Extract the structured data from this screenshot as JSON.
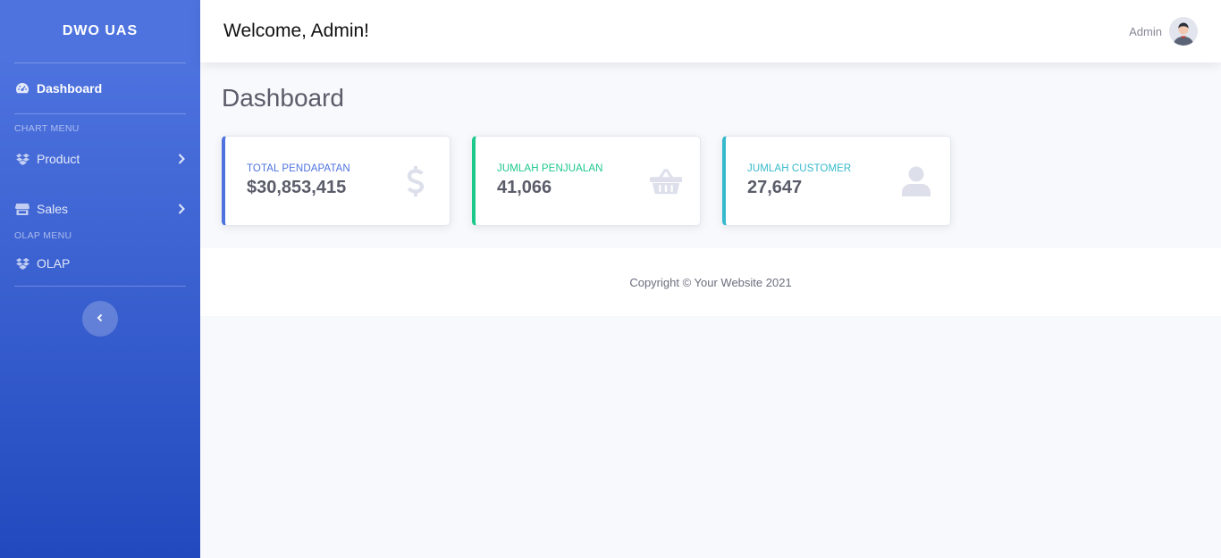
{
  "sidebar": {
    "brand": "DWO UAS",
    "dashboard_label": "Dashboard",
    "chart_heading": "CHART MENU",
    "olap_heading": "OLAP MENU",
    "items": [
      {
        "label": "Product",
        "icon": "dropbox-icon"
      },
      {
        "label": "Sales",
        "icon": "store-icon"
      },
      {
        "label": "OLAP",
        "icon": "dropbox-icon"
      }
    ]
  },
  "topbar": {
    "welcome": "Welcome, Admin!",
    "user_name": "Admin"
  },
  "main": {
    "title": "Dashboard",
    "cards": [
      {
        "label": "TOTAL PENDAPATAN",
        "value": "$30,853,415",
        "color": "#4e73df",
        "icon": "dollar-icon"
      },
      {
        "label": "JUMLAH PENJUALAN",
        "value": "41,066",
        "color": "#1cc88a",
        "icon": "basket-icon"
      },
      {
        "label": "JUMLAH CUSTOMER",
        "value": "27,647",
        "color": "#36b9cc",
        "icon": "user-icon"
      }
    ]
  },
  "footer": {
    "copyright": "Copyright © Your Website 2021"
  },
  "colors": {
    "primary": "#4e73df",
    "success": "#1cc88a",
    "info": "#36b9cc",
    "text": "#5a5c69"
  }
}
